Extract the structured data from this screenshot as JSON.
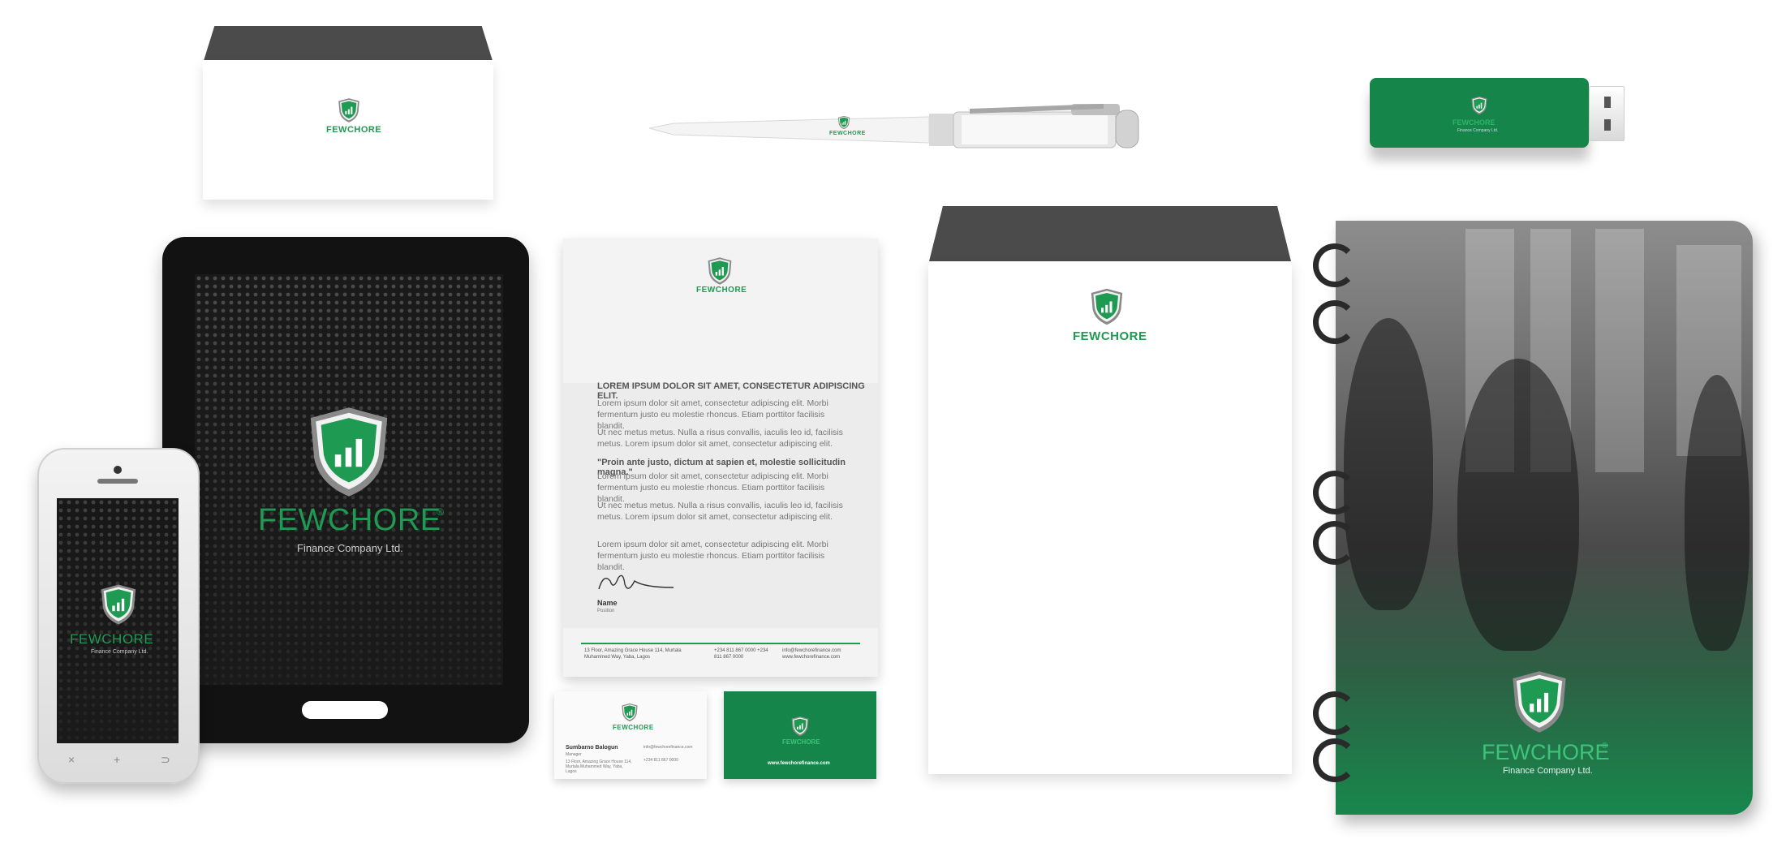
{
  "brand": {
    "name": "FEWCHORE",
    "registered": "®",
    "tagline": "Finance Company Ltd.",
    "colors": {
      "green": "#1f9a52",
      "dark_green": "#15854a",
      "charcoal": "#4b4b4b"
    }
  },
  "letterhead": {
    "heading": "LOREM IPSUM DOLOR SIT AMET, CONSECTETUR ADIPISCING ELIT.",
    "para1": "Lorem ipsum dolor sit amet, consectetur adipiscing elit. Morbi fermentum justo eu molestie rhoncus. Etiam porttitor facilisis blandit.",
    "para2": "Ut nec metus metus. Nulla a risus convallis, iaculis leo id, facilisis metus. Lorem ipsum dolor sit amet, consectetur adipiscing elit.",
    "quote": "\"Proin ante justo, dictum at sapien et, molestie sollicitudin magna.\"",
    "para3": "Lorem ipsum dolor sit amet, consectetur adipiscing elit. Morbi fermentum justo eu molestie rhoncus. Etiam porttitor facilisis blandit.",
    "para4": "Ut nec metus metus. Nulla a risus convallis, iaculis leo id, facilisis metus. Lorem ipsum dolor sit amet, consectetur adipiscing elit.",
    "para5": "Lorem ipsum dolor sit amet, consectetur adipiscing elit. Morbi fermentum justo eu molestie rhoncus. Etiam porttitor facilisis blandit.",
    "signer_name": "Name",
    "signer_title": "Position",
    "footer_address": "13 Floor, Amazing Grace House 114, Murtala Muhammed Way, Yaba, Lagos",
    "footer_phone": "+234 811 867 0000 +234 811 867 0000",
    "footer_web": "info@fewchorefinance.com www.fewchorefinance.com"
  },
  "business_card": {
    "name": "Sumbarno Balogun",
    "title": "Manager",
    "address": "13 Floor, Amazing Grace House 114, Murtala Muhammed Way, Yaba, Lagos",
    "email": "info@fewchorefinance.com",
    "phone": "+234 811 867 0000",
    "website": "www.fewchorefinance.com"
  },
  "phone_nav": {
    "left": "×",
    "center": "+",
    "right": "⊃"
  }
}
